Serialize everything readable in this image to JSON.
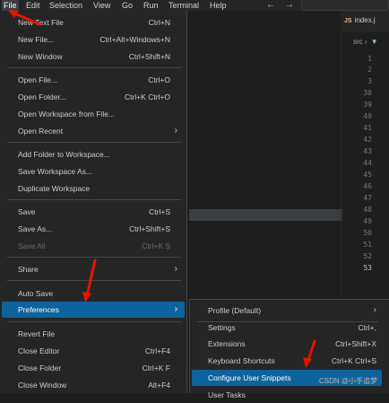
{
  "menubar": {
    "items": [
      {
        "label": "File",
        "active": true
      },
      {
        "label": "Edit"
      },
      {
        "label": "Selection"
      },
      {
        "label": "View"
      },
      {
        "label": "Go"
      },
      {
        "label": "Run"
      },
      {
        "label": "Terminal"
      },
      {
        "label": "Help"
      }
    ],
    "back_icon": "arrow-left-icon",
    "forward_icon": "arrow-right-icon"
  },
  "editor": {
    "tab_label": "index.j",
    "tab_icon_text": "JS",
    "breadcrumb": "src",
    "line_numbers": [
      "1",
      "2",
      "3",
      "38",
      "39",
      "40",
      "41",
      "42",
      "43",
      "44",
      "45",
      "46",
      "47",
      "48",
      "49",
      "50",
      "51",
      "52",
      "53"
    ],
    "current_line": "53"
  },
  "file_menu": {
    "items": [
      {
        "label": "New Text File",
        "key": "Ctrl+N"
      },
      {
        "label": "New File...",
        "key": "Ctrl+Alt+Windows+N"
      },
      {
        "label": "New Window",
        "key": "Ctrl+Shift+N"
      },
      {
        "label": "Open File...",
        "key": "Ctrl+O"
      },
      {
        "label": "Open Folder...",
        "key": "Ctrl+K Ctrl+O"
      },
      {
        "label": "Open Workspace from File...",
        "key": ""
      },
      {
        "label": "Open Recent",
        "key": ""
      },
      {
        "label": "Add Folder to Workspace...",
        "key": ""
      },
      {
        "label": "Save Workspace As...",
        "key": ""
      },
      {
        "label": "Duplicate Workspace",
        "key": ""
      },
      {
        "label": "Save",
        "key": "Ctrl+S"
      },
      {
        "label": "Save As...",
        "key": "Ctrl+Shift+S"
      },
      {
        "label": "Save All",
        "key": "Ctrl+K S"
      },
      {
        "label": "Share",
        "key": ""
      },
      {
        "label": "Auto Save",
        "key": ""
      },
      {
        "label": "Preferences",
        "key": ""
      },
      {
        "label": "Revert File",
        "key": ""
      },
      {
        "label": "Close Editor",
        "key": "Ctrl+F4"
      },
      {
        "label": "Close Folder",
        "key": "Ctrl+K F"
      },
      {
        "label": "Close Window",
        "key": "Alt+F4"
      }
    ]
  },
  "preferences_submenu": {
    "items": [
      {
        "label": "Profile (Default)",
        "key": ""
      },
      {
        "label": "Settings",
        "key": "Ctrl+,"
      },
      {
        "label": "Extensions",
        "key": "Ctrl+Shift+X"
      },
      {
        "label": "Keyboard Shortcuts",
        "key": "Ctrl+K Ctrl+S"
      },
      {
        "label": "Configure User Snippets",
        "key": ""
      },
      {
        "label": "User Tasks",
        "key": ""
      }
    ]
  },
  "watermark": "CSDN @小手追梦",
  "colors": {
    "highlight": "#0e639c",
    "annotation_arrow": "#e51400",
    "menu_bg": "#252526"
  }
}
